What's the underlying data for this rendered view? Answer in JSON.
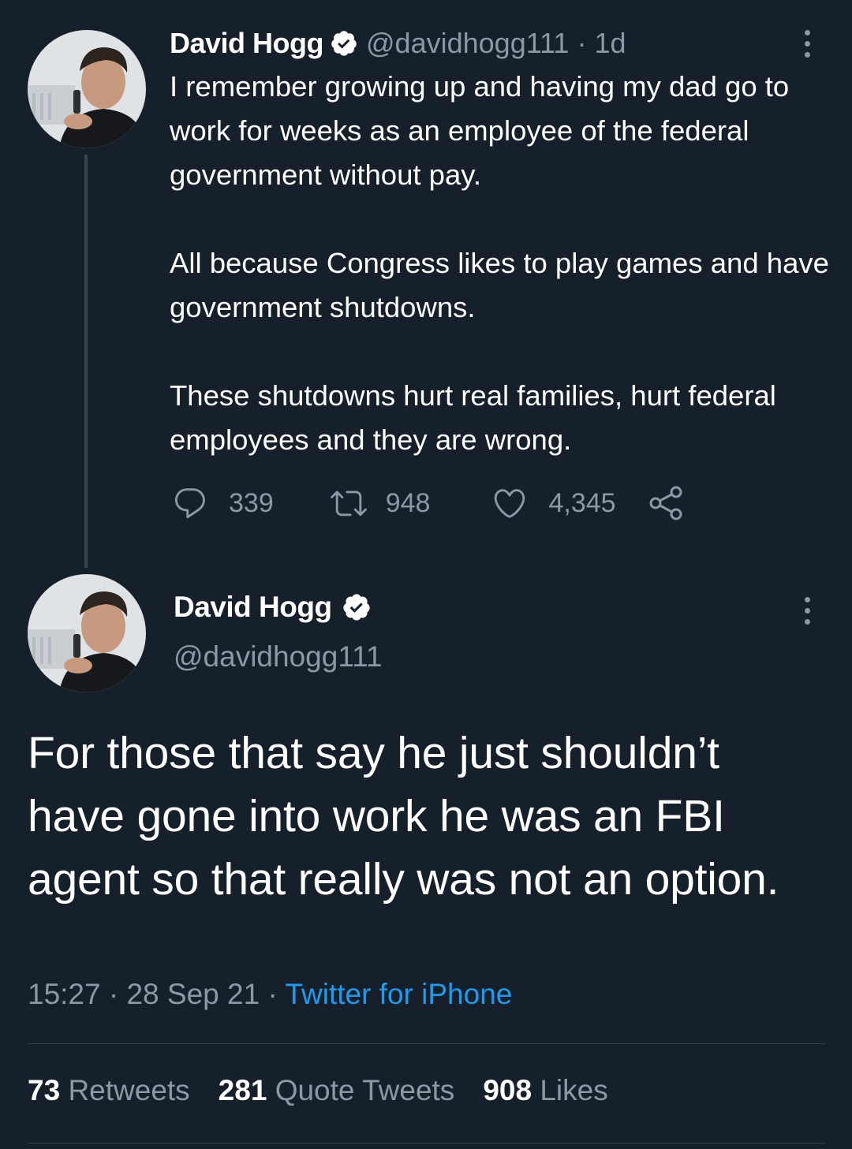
{
  "parent_tweet": {
    "author_name": "David Hogg",
    "handle": "@davidhogg111",
    "separator": "·",
    "time_ago": "1d",
    "paragraphs": [
      "I remember growing up and having my dad go to work for weeks as an employee of the federal government without pay.",
      "All because Congress likes to play games and have government shutdowns.",
      "These shutdowns hurt real families, hurt federal employees and they are wrong."
    ],
    "replies": "339",
    "retweets": "948",
    "likes": "4,345"
  },
  "main_tweet": {
    "author_name": "David Hogg",
    "handle": "@davidhogg111",
    "text": "For those that say he just shouldn’t have gone into work he was an FBI agent so that really was not an option.",
    "time": "15:27",
    "date": "28 Sep 21",
    "separator": "·",
    "source": "Twitter for iPhone",
    "stats": {
      "retweets_count": "73",
      "retweets_label": "Retweets",
      "quotes_count": "281",
      "quotes_label": "Quote Tweets",
      "likes_count": "908",
      "likes_label": "Likes"
    }
  },
  "colors": {
    "background": "#15202b",
    "primary_text": "#ffffff",
    "secondary_text": "#8b98a5",
    "link": "#1d9bf0",
    "verified_badge": "#ffffff"
  },
  "icons": [
    "verified-badge-icon",
    "more-options-icon",
    "reply-icon",
    "retweet-icon",
    "like-icon",
    "share-icon"
  ]
}
